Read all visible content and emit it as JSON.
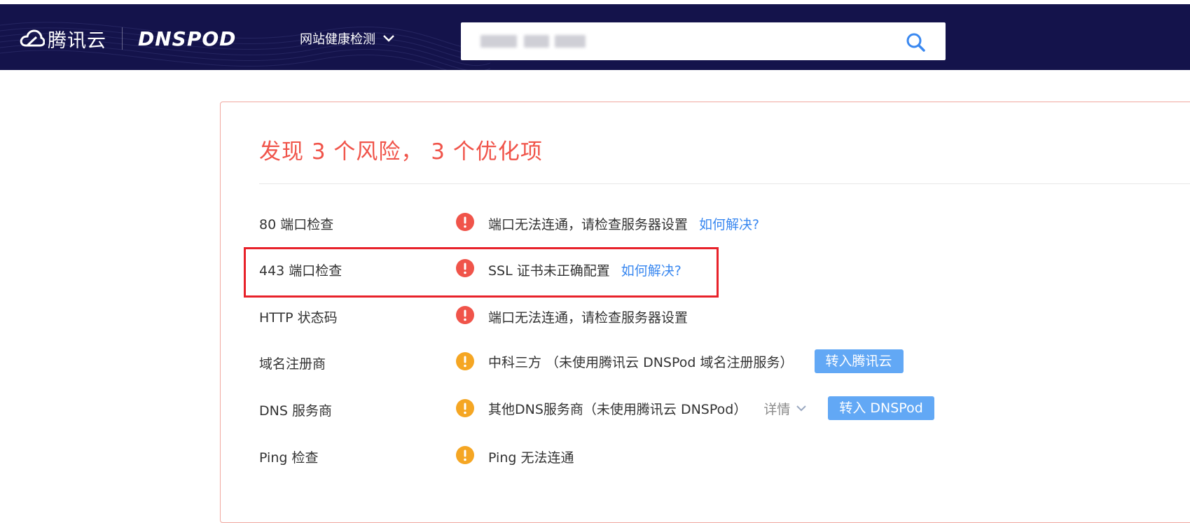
{
  "header": {
    "brand_cn": "腾讯云",
    "brand_dns": "DNSPOD",
    "nav_label": "网站健康检测",
    "search_value": "",
    "colors": {
      "bg": "#14134b",
      "accent": "#3a88f0"
    }
  },
  "report": {
    "title": "发现 3 个风险， 3 个优化项",
    "rows": [
      {
        "label": "80 端口检查",
        "level": "risk",
        "message": "端口无法连通，请检查服务器设置",
        "link": "如何解决?"
      },
      {
        "label": "443 端口检查",
        "level": "risk",
        "message": "SSL 证书未正确配置",
        "link": "如何解决?"
      },
      {
        "label": "HTTP 状态码",
        "level": "risk",
        "message": "端口无法连通，请检查服务器设置"
      },
      {
        "label": "域名注册商",
        "level": "warn",
        "message": "中科三方 （未使用腾讯云 DNSPod 域名注册服务）",
        "button": "转入腾讯云"
      },
      {
        "label": "DNS 服务商",
        "level": "warn",
        "message": "其他DNS服务商（未使用腾讯云 DNSPod）",
        "detail": "详情",
        "button": "转入 DNSPod"
      },
      {
        "label": "Ping 检查",
        "level": "warn",
        "message": "Ping 无法连通"
      }
    ],
    "colors": {
      "risk": "#f0544a",
      "warn": "#f5a623",
      "button": "#62a8f5",
      "highlight": "#e8222a"
    }
  }
}
